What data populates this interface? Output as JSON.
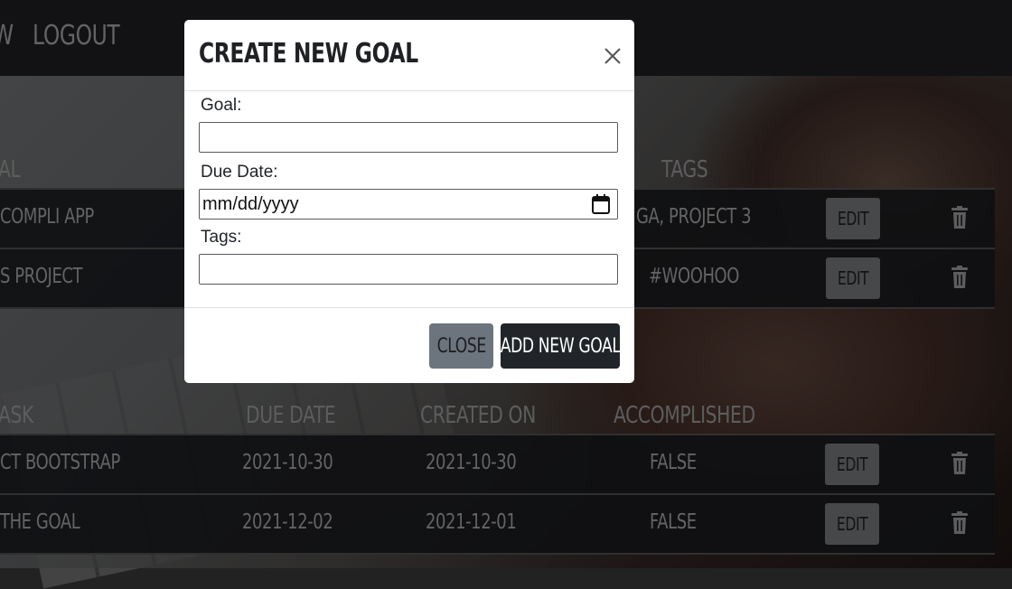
{
  "navbar": {
    "partial_link": "W",
    "logout": "LOGOUT"
  },
  "goals_table": {
    "headers": {
      "goal": "AL",
      "tags": "TAGS"
    },
    "rows": [
      {
        "goal": "COMPLI APP",
        "tags": "GA, PROJECT 3",
        "edit": "EDIT"
      },
      {
        "goal": "S PROJECT",
        "tags": "#WOOHOO",
        "edit": "EDIT"
      }
    ]
  },
  "tasks_table": {
    "headers": {
      "task": "ASK",
      "due_date": "DUE DATE",
      "created_on": "CREATED ON",
      "accomplished": "ACCOMPLISHED"
    },
    "rows": [
      {
        "task": "CT BOOTSTRAP",
        "due_date": "2021-10-30",
        "created_on": "2021-10-30",
        "accomplished": "FALSE",
        "edit": "EDIT"
      },
      {
        "task": "THE GOAL",
        "due_date": "2021-12-02",
        "created_on": "2021-12-01",
        "accomplished": "FALSE",
        "edit": "EDIT"
      }
    ]
  },
  "modal": {
    "title": "CREATE NEW GOAL",
    "goal_label": "Goal:",
    "goal_value": "",
    "due_date_label": "Due Date:",
    "due_date_placeholder": "mm/dd/yyyy",
    "tags_label": "Tags:",
    "tags_value": "",
    "close_button": "CLOSE",
    "add_button": "ADD NEW GOAL"
  },
  "colors": {
    "navbar": "#1c1d20",
    "row_bg": "#18191c",
    "edit_button": "#6d6f72",
    "close_button": "#6c757d",
    "add_button": "#212529"
  },
  "icons": [
    "trash-icon",
    "calendar-icon",
    "close-icon"
  ]
}
